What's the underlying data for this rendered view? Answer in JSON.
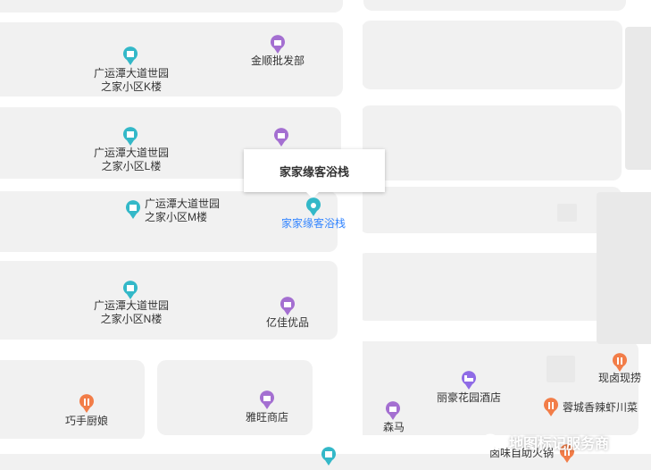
{
  "map": {
    "popup": {
      "title": "家家缘客浴栈"
    },
    "pois": [
      {
        "name": "广运潭大道世园\n之家小区K楼",
        "icon": "building-icon",
        "color": "#33b8c8"
      },
      {
        "name": "金顺批发部",
        "icon": "shop-icon",
        "color": "#a46fd1"
      },
      {
        "name": "广运潭大道世园\n之家小区L楼",
        "icon": "building-icon",
        "color": "#33b8c8"
      },
      {
        "name": "",
        "icon": "shop-icon",
        "color": "#a46fd1"
      },
      {
        "name": "广运潭大道世园\n之家小区M楼",
        "icon": "building-icon",
        "color": "#33b8c8"
      },
      {
        "name": "家家缘客浴栈",
        "icon": "location-pin-icon",
        "color": "#33b8c8"
      },
      {
        "name": "广运潭大道世园\n之家小区N楼",
        "icon": "building-icon",
        "color": "#33b8c8"
      },
      {
        "name": "亿佳优品",
        "icon": "shop-icon",
        "color": "#a46fd1"
      },
      {
        "name": "巧手厨娘",
        "icon": "restaurant-icon",
        "color": "#f27d48"
      },
      {
        "name": "雅旺商店",
        "icon": "shop-icon",
        "color": "#a46fd1"
      },
      {
        "name": "森马",
        "icon": "shop-icon",
        "color": "#a46fd1"
      },
      {
        "name": "丽豪花园酒店",
        "icon": "hotel-icon",
        "color": "#8f6be6"
      },
      {
        "name": "现卤现捞",
        "icon": "restaurant-icon",
        "color": "#f27d48"
      },
      {
        "name": "蓉城香辣虾川菜",
        "icon": "restaurant-icon",
        "color": "#f27d48"
      },
      {
        "name": "卤味自助火锅",
        "icon": "restaurant-icon",
        "color": "#f27d48"
      },
      {
        "name": "",
        "icon": "building-icon",
        "color": "#33b8c8"
      }
    ]
  },
  "watermark": {
    "text": "地图标记服务商",
    "icon": "wechat-icon"
  }
}
